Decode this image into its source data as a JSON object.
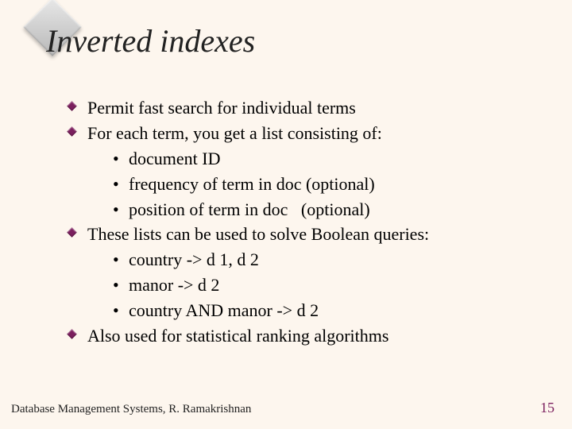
{
  "title": "Inverted indexes",
  "bullets": {
    "b1": "Permit fast search for individual terms",
    "b2": "For each term, you get a list consisting of:",
    "b2s1": "document ID",
    "b2s2": "frequency of term in doc (optional)",
    "b2s3": "position of term in doc   (optional)",
    "b3": "These lists can be used to solve Boolean queries:",
    "b3s1": "country -> d 1, d 2",
    "b3s2": "manor -> d 2",
    "b3s3": "country AND manor -> d 2",
    "b4": "Also used for statistical ranking algorithms"
  },
  "dot": "•",
  "footer": {
    "left": "Database Management Systems, R. Ramakrishnan",
    "right": "15"
  }
}
